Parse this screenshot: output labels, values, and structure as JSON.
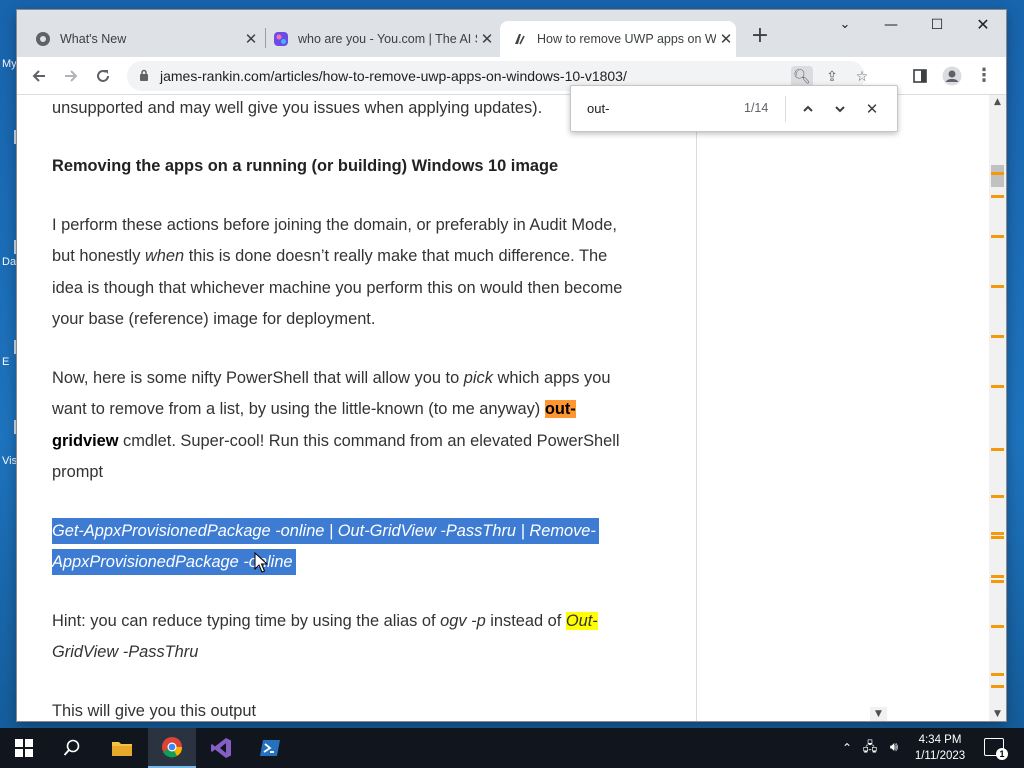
{
  "desktop": {
    "icon_labels": [
      "My",
      "Da",
      "E",
      "Vis"
    ]
  },
  "browser": {
    "tabs": [
      {
        "title": "What's New",
        "icon": "chrome-icon",
        "active": false
      },
      {
        "title": "who are you - You.com | The AI S",
        "icon": "youcom-icon",
        "active": false
      },
      {
        "title": "How to remove UWP apps on W",
        "icon": "jamesrankin-icon",
        "active": true
      }
    ],
    "url": "james-rankin.com/articles/how-to-remove-uwp-apps-on-windows-10-v1803/",
    "find": {
      "query": "out-",
      "count": "1/14"
    }
  },
  "article": {
    "p0": "unsupported and may well give you issues when applying updates).",
    "heading": "Removing the apps on a running (or building) Windows 10 image",
    "p1_l1": "I perform these actions before joining the domain, or preferably in Audit Mode,",
    "p1_l2a": "but honestly ",
    "p1_l2b": "when",
    "p1_l2c": " this is done doesn’t really make that much difference. The",
    "p1_l3": "idea is though that whichever machine you perform this on would then become",
    "p1_l4": "your base (reference) image for deployment.",
    "p2_l1a": "Now, here is some nifty PowerShell that will allow you to ",
    "p2_l1b": "pick",
    "p2_l1c": " which apps you",
    "p2_l2a": "want to remove from a list, by using the little-known (to me anyway) ",
    "p2_l2b": "out-",
    "p2_l3a": "gridview",
    "p2_l3b": " cmdlet. Super-cool! Run this command from an elevated PowerShell",
    "p2_l4": "prompt",
    "code_l1": "Get-AppxProvisionedPackage -online | Out-GridView -PassThru | Remove-",
    "code_l2": "AppxProvisionedPackage -online",
    "hint_l1a": "Hint: you can reduce typing time by using the alias of ",
    "hint_l1b": "ogv -p",
    "hint_l1c": " instead of ",
    "hint_l1d": "Out-",
    "hint_l2": "GridView -PassThru",
    "p3": "This will give you this output"
  },
  "taskbar": {
    "apps": [
      "file-explorer",
      "chrome",
      "visual-studio",
      "powershell"
    ],
    "time": "4:34 PM",
    "date": "1/11/2023",
    "notification_count": "1"
  },
  "colors": {
    "find_current": "#ff9632",
    "find_match": "#ffff00",
    "selection": "#3d7cd2"
  }
}
